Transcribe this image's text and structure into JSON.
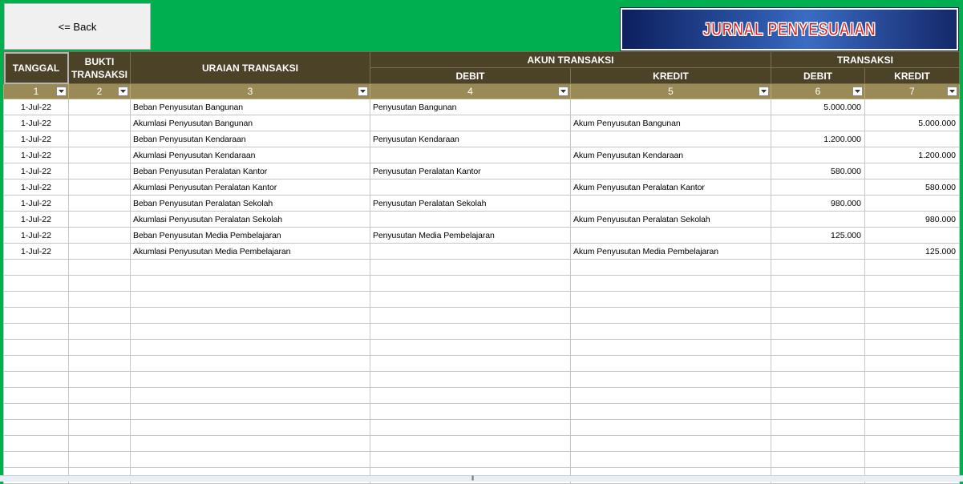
{
  "back_label": "<= Back",
  "title": "JURNAL PENYESUAIAN",
  "header": {
    "tanggal": "TANGGAL",
    "bukti": "BUKTI TRANSAKSI",
    "uraian": "URAIAN TRANSAKSI",
    "akun_transaksi": "AKUN TRANSAKSI",
    "transaksi": "TRANSAKSI",
    "debit": "DEBIT",
    "kredit": "KREDIT"
  },
  "column_numbers": [
    "1",
    "2",
    "3",
    "4",
    "5",
    "6",
    "7"
  ],
  "rows": [
    {
      "tanggal": "1-Jul-22",
      "bukti": "",
      "uraian": "Beban Penyusutan Bangunan",
      "akun_debit": "Penyusutan Bangunan",
      "akun_kredit": "",
      "debit": "5.000.000",
      "kredit": ""
    },
    {
      "tanggal": "1-Jul-22",
      "bukti": "",
      "uraian": "Akumlasi Penyusutan Bangunan",
      "akun_debit": "",
      "akun_kredit": "Akum Penyusutan Bangunan",
      "debit": "",
      "kredit": "5.000.000"
    },
    {
      "tanggal": "1-Jul-22",
      "bukti": "",
      "uraian": "Beban Penyusutan Kendaraan",
      "akun_debit": "Penyusutan Kendaraan",
      "akun_kredit": "",
      "debit": "1.200.000",
      "kredit": ""
    },
    {
      "tanggal": "1-Jul-22",
      "bukti": "",
      "uraian": "Akumlasi Penyusutan Kendaraan",
      "akun_debit": "",
      "akun_kredit": "Akum Penyusutan Kendaraan",
      "debit": "",
      "kredit": "1.200.000"
    },
    {
      "tanggal": "1-Jul-22",
      "bukti": "",
      "uraian": "Beban Penyusutan Peralatan Kantor",
      "akun_debit": "Penyusutan Peralatan Kantor",
      "akun_kredit": "",
      "debit": "580.000",
      "kredit": ""
    },
    {
      "tanggal": "1-Jul-22",
      "bukti": "",
      "uraian": "Akumlasi Penyusutan Peralatan Kantor",
      "akun_debit": "",
      "akun_kredit": "Akum Penyusutan Peralatan Kantor",
      "debit": "",
      "kredit": "580.000"
    },
    {
      "tanggal": "1-Jul-22",
      "bukti": "",
      "uraian": "Beban Penyusutan Peralatan Sekolah",
      "akun_debit": "Penyusutan Peralatan Sekolah",
      "akun_kredit": "",
      "debit": "980.000",
      "kredit": ""
    },
    {
      "tanggal": "1-Jul-22",
      "bukti": "",
      "uraian": "Akumlasi Penyusutan Peralatan Sekolah",
      "akun_debit": "",
      "akun_kredit": "Akum Penyusutan Peralatan Sekolah",
      "debit": "",
      "kredit": "980.000"
    },
    {
      "tanggal": "1-Jul-22",
      "bukti": "",
      "uraian": "Beban Penyusutan Media Pembelajaran",
      "akun_debit": "Penyusutan Media Pembelajaran",
      "akun_kredit": "",
      "debit": "125.000",
      "kredit": ""
    },
    {
      "tanggal": "1-Jul-22",
      "bukti": "",
      "uraian": "Akumlasi Penyusutan Media Pembelajaran",
      "akun_debit": "",
      "akun_kredit": "Akum Penyusutan Media Pembelajaran",
      "debit": "",
      "kredit": "125.000"
    }
  ],
  "empty_rows": 14,
  "colors": {
    "background": "#00b050",
    "header": "#4b4228",
    "number_row": "#9a8a55",
    "title_text": "#d42020"
  }
}
